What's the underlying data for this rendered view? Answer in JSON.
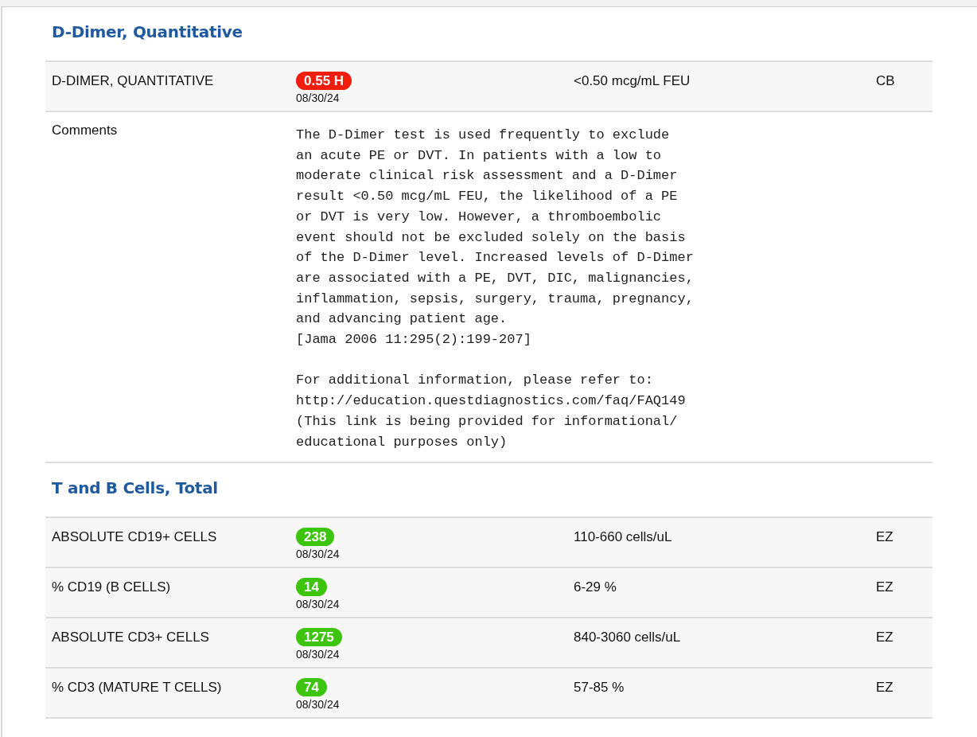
{
  "sections": [
    {
      "title": "D-Dimer, Quantitative",
      "rows": [
        {
          "kind": "result",
          "name": "D-DIMER, QUANTITATIVE",
          "value": "0.55 H",
          "color": "#f01c0c",
          "date": "08/30/24",
          "range": "<0.50 mcg/mL FEU",
          "lab": "CB"
        },
        {
          "kind": "comment",
          "name": "Comments",
          "text": "The D-Dimer test is used frequently to exclude\nan acute PE or DVT. In patients with a low to\nmoderate clinical risk assessment and a D-Dimer\nresult <0.50 mcg/mL FEU, the likelihood of a PE\nor DVT is very low. However, a thromboembolic\nevent should not be excluded solely on the basis\nof the D-Dimer level. Increased levels of D-Dimer\nare associated with a PE, DVT, DIC, malignancies,\ninflammation, sepsis, surgery, trauma, pregnancy,\nand advancing patient age.\n[Jama 2006 11:295(2):199-207]\n\nFor additional information, please refer to:\nhttp://education.questdiagnostics.com/faq/FAQ149\n(This link is being provided for informational/\neducational purposes only)"
        }
      ]
    },
    {
      "title": "T and B Cells, Total",
      "rows": [
        {
          "kind": "result",
          "name": "ABSOLUTE CD19+ CELLS",
          "value": "238",
          "color": "#3cc40e",
          "date": "08/30/24",
          "range": "110-660 cells/uL",
          "lab": "EZ"
        },
        {
          "kind": "result",
          "name": "% CD19 (B CELLS)",
          "value": "14",
          "color": "#3cc40e",
          "date": "08/30/24",
          "range": "6-29 %",
          "lab": "EZ"
        },
        {
          "kind": "result",
          "name": "ABSOLUTE CD3+ CELLS",
          "value": "1275",
          "color": "#3cc40e",
          "date": "08/30/24",
          "range": "840-3060 cells/uL",
          "lab": "EZ"
        },
        {
          "kind": "result",
          "name": "% CD3 (MATURE T CELLS)",
          "value": "74",
          "color": "#3cc40e",
          "date": "08/30/24",
          "range": "57-85 %",
          "lab": "EZ"
        }
      ]
    }
  ]
}
